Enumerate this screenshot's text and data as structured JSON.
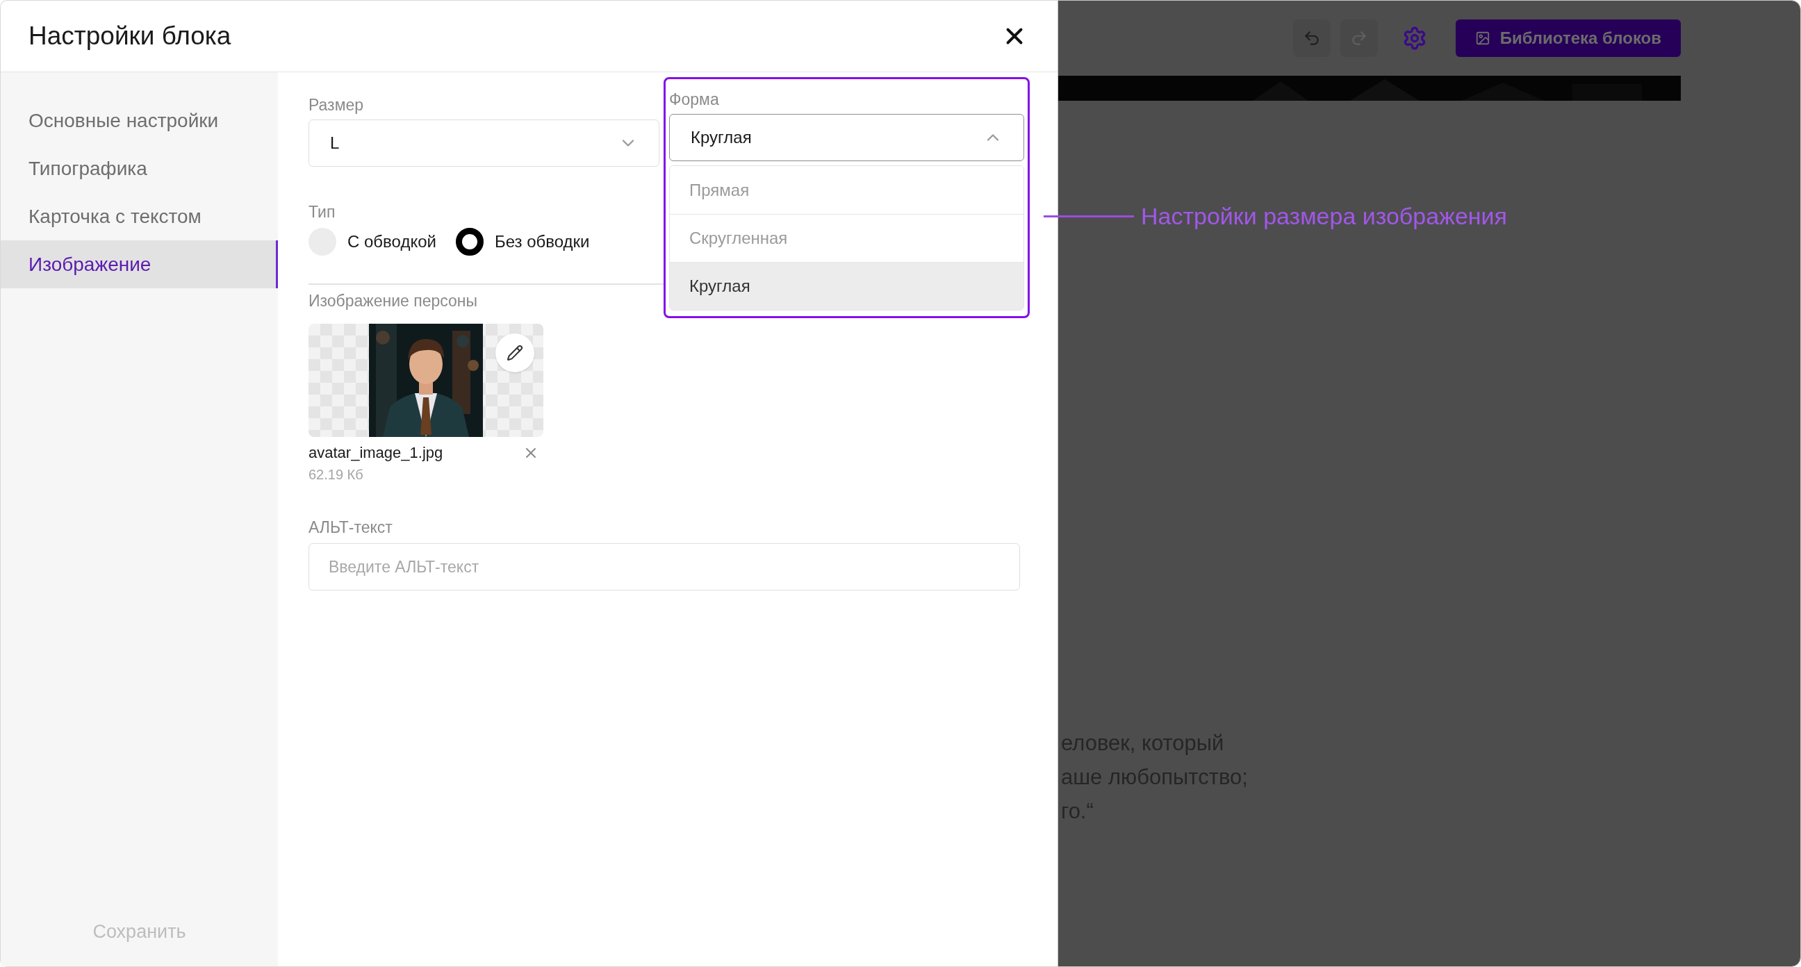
{
  "modal": {
    "title": "Настройки блока",
    "sidebar": {
      "items": [
        {
          "label": "Основные настройки",
          "selected": false
        },
        {
          "label": "Типографика",
          "selected": false
        },
        {
          "label": "Карточка с текстом",
          "selected": false
        },
        {
          "label": "Изображение",
          "selected": true
        }
      ],
      "save_button": {
        "label": "Сохранить",
        "disabled": true
      }
    },
    "size_field": {
      "label": "Размер",
      "value": "L",
      "expanded": false
    },
    "shape_field": {
      "label": "Форма",
      "value": "Круглая",
      "expanded": true,
      "options": [
        {
          "label": "Прямая",
          "selected": false
        },
        {
          "label": "Скругленная",
          "selected": false
        },
        {
          "label": "Круглая",
          "selected": true
        }
      ]
    },
    "type_field": {
      "label": "Тип",
      "options": [
        {
          "label": "С обводкой",
          "selected": false
        },
        {
          "label": "Без обводки",
          "selected": true
        }
      ]
    },
    "image_field": {
      "label": "Изображение персоны",
      "file_name": "avatar_image_1.jpg",
      "file_size": "62.19 Кб"
    },
    "alt_field": {
      "label": "АЛЬТ-текст",
      "placeholder": "Введите АЛЬТ-текст"
    }
  },
  "canvas": {
    "toolbar": {
      "undo_disabled": false,
      "redo_disabled": true,
      "library_button": "Библиотека блоков"
    },
    "text_lines": [
      "еловек, который",
      "аше любопытство;",
      "го.“"
    ]
  },
  "annotation": {
    "text": "Настройки размера изображения"
  }
}
